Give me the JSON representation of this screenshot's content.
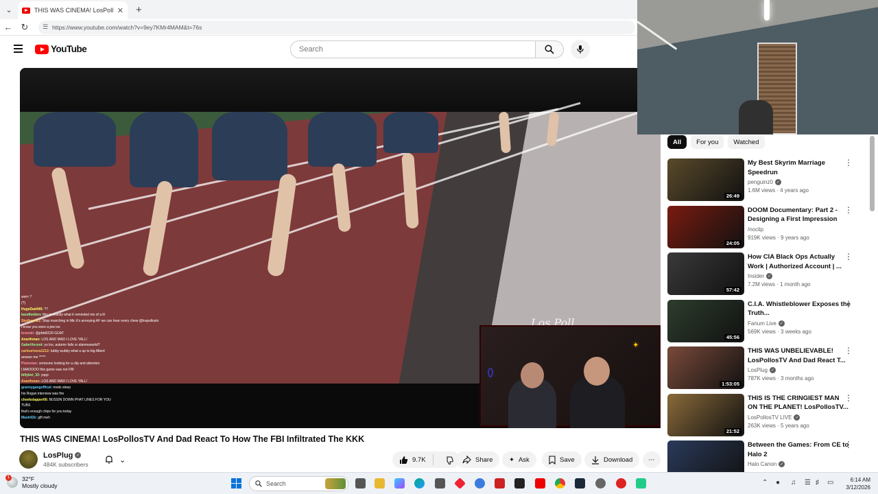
{
  "browser": {
    "tab_title": "THIS WAS CINEMA! LosPollosTV A",
    "url": "https://www.youtube.com/watch?v=9ey7KMr4MAM&t=76s"
  },
  "header": {
    "logo_text": "YouTube",
    "search_placeholder": "Search"
  },
  "video": {
    "signature": "Los Poll",
    "title": "THIS WAS CINEMA! LosPollosTV And Dad React To How The FBI Infiltrated The KKK",
    "chat": [
      {
        "user": "",
        "msg": "wern ?"
      },
      {
        "user": "",
        "msg": "(?)"
      },
      {
        "user": "HugeDad449:",
        "msg": "??"
      },
      {
        "user": "bandhelden:",
        "msg": "this is exactly what it reminded me of a lil"
      },
      {
        "user": "Skolboy421:",
        "msg": "Stop munching in Mic it's annoying AF we can hear every chew @lospollostv"
      },
      {
        "user": "",
        "msg": "i know you wore a jew iso"
      },
      {
        "user": "kronski:",
        "msg": "@pfdd0220 GOAT"
      },
      {
        "user": "Anarthman:",
        "msg": "LOS AND WAD I LOVE YALL!"
      },
      {
        "user": "GabeVincent:",
        "msg": "yo los, autumn falls or alanmaworld?"
      },
      {
        "user": "carloorivera1212:",
        "msg": "tubby wubby what u up to big Albert"
      },
      {
        "user": "",
        "msg": "answer me *****"
      },
      {
        "user": "Plutonian:",
        "msg": "someone looking for a clip and attention"
      },
      {
        "user": "",
        "msg": "LMAOOOO this game was not FBI"
      },
      {
        "user": "billyboi_33:",
        "msg": "yupp"
      },
      {
        "user": "Anarthman:",
        "msg": "LOS AND WAD I LOVE YALL!"
      },
      {
        "user": "grannygangoffical:",
        "msg": "mods sleep"
      },
      {
        "user": "",
        "msg": "his Rogan interview was fire"
      },
      {
        "user": "cheekslapper66:",
        "msg": "BUSSIN DOWN PHAT LINES FOR YOU"
      },
      {
        "user": "",
        "msg": "TUBS"
      },
      {
        "user": "",
        "msg": "that's enough chips for you today"
      },
      {
        "user": "Mash42k:",
        "msg": "gift meh"
      }
    ]
  },
  "channel": {
    "name": "LosPlug",
    "subscribers": "484K subscribers"
  },
  "actions": {
    "likes": "9.7K",
    "share": "Share",
    "ask": "Ask",
    "save": "Save",
    "download": "Download"
  },
  "chips": [
    "All",
    "For you",
    "Watched"
  ],
  "recommendations": [
    {
      "title": "My Best Skyrim Marriage Speedrun",
      "channel": "penguinz0",
      "verified": true,
      "meta": "1.6M views · 4 years ago",
      "duration": "26:49",
      "color": "#5a4a2a"
    },
    {
      "title": "DOOM Documentary: Part 2 - Designing a First Impression",
      "channel": "/noclip",
      "verified": false,
      "meta": "919K views · 9 years ago",
      "duration": "24:05",
      "color": "#7a1b10"
    },
    {
      "title": "How CIA Black Ops Actually Work | Authorized Account | ...",
      "channel": "Insider",
      "verified": true,
      "meta": "7.2M views · 1 month ago",
      "duration": "57:42",
      "color": "#3a3a3a"
    },
    {
      "title": "C.I.A. Whistleblower Exposes the Truth...",
      "channel": "Fanum Live",
      "verified": true,
      "meta": "569K views · 3 weeks ago",
      "duration": "45:56",
      "color": "#2d3d2d"
    },
    {
      "title": "THIS WAS UNBELIEVABLE! LosPollosTV And Dad React T...",
      "channel": "LosPlug",
      "verified": true,
      "meta": "787K views · 3 months ago",
      "duration": "1:53:05",
      "color": "#7a4a3a"
    },
    {
      "title": "THIS IS THE CRINGIEST MAN ON THE PLANET! LosPollosTV...",
      "channel": "LosPollosTV LIVE",
      "verified": true,
      "meta": "263K views · 5 years ago",
      "duration": "21:52",
      "color": "#8a6a3a"
    },
    {
      "title": "Between the Games: From CE to Halo 2",
      "channel": "Halo Canon",
      "verified": true,
      "meta": "",
      "duration": "",
      "color": "#2a3a5a"
    }
  ],
  "taskbar": {
    "weather_temp": "32°F",
    "weather_desc": "Mostly cloudy",
    "weather_badge": "1",
    "search_label": "Search",
    "time": "6:14 AM",
    "date": "3/12/2026"
  }
}
